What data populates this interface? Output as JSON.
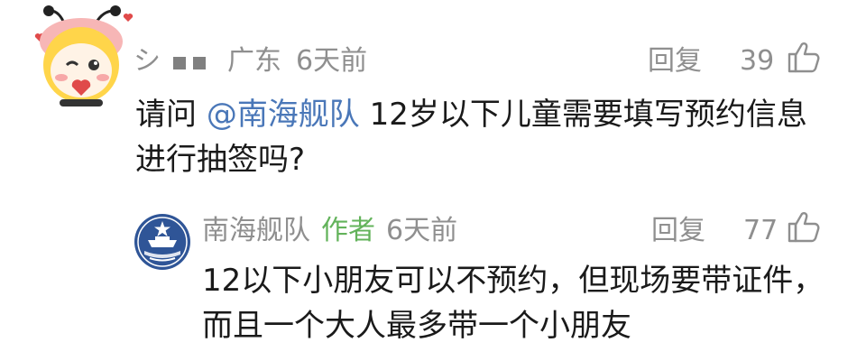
{
  "top_comment": {
    "location": "广东",
    "time": "6天前",
    "reply_label": "回复",
    "like_count": "39",
    "text_prefix": "请问 ",
    "mention": "@南海舰队",
    "text_rest": " 12岁以下儿童需要填写预约信息进行抽签吗?"
  },
  "reply_comment": {
    "username": "南海舰队",
    "author_badge": "作者",
    "time": "6天前",
    "reply_label": "回复",
    "like_count": "77",
    "text": "12以下小朋友可以不预约，但现场要带证件，而且一个大人最多带一个小朋友"
  },
  "colors": {
    "meta_gray": "#8f8f8f",
    "text": "#1a1a1a",
    "mention_blue": "#4a77b8",
    "author_green": "#63b35b"
  },
  "icons": [
    "bee-avatar-icon",
    "navy-emblem-icon",
    "thumbs-up-icon"
  ]
}
